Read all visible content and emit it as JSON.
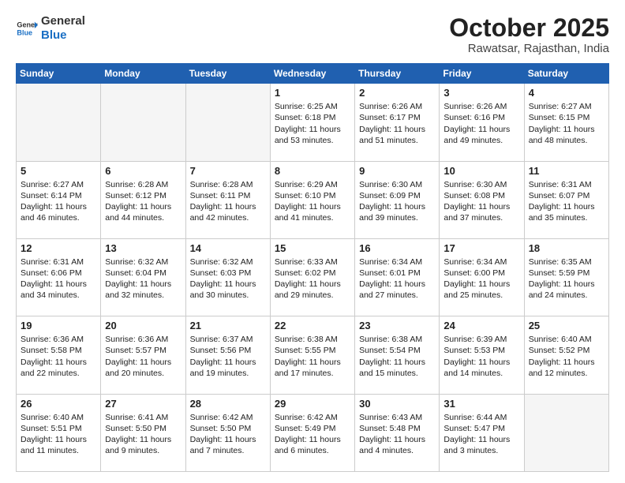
{
  "header": {
    "logo_general": "General",
    "logo_blue": "Blue",
    "month_title": "October 2025",
    "location": "Rawatsar, Rajasthan, India"
  },
  "days_of_week": [
    "Sunday",
    "Monday",
    "Tuesday",
    "Wednesday",
    "Thursday",
    "Friday",
    "Saturday"
  ],
  "weeks": [
    [
      {
        "day": "",
        "lines": [],
        "empty": true
      },
      {
        "day": "",
        "lines": [],
        "empty": true
      },
      {
        "day": "",
        "lines": [],
        "empty": true
      },
      {
        "day": "1",
        "lines": [
          "Sunrise: 6:25 AM",
          "Sunset: 6:18 PM",
          "Daylight: 11 hours",
          "and 53 minutes."
        ],
        "empty": false
      },
      {
        "day": "2",
        "lines": [
          "Sunrise: 6:26 AM",
          "Sunset: 6:17 PM",
          "Daylight: 11 hours",
          "and 51 minutes."
        ],
        "empty": false
      },
      {
        "day": "3",
        "lines": [
          "Sunrise: 6:26 AM",
          "Sunset: 6:16 PM",
          "Daylight: 11 hours",
          "and 49 minutes."
        ],
        "empty": false
      },
      {
        "day": "4",
        "lines": [
          "Sunrise: 6:27 AM",
          "Sunset: 6:15 PM",
          "Daylight: 11 hours",
          "and 48 minutes."
        ],
        "empty": false
      }
    ],
    [
      {
        "day": "5",
        "lines": [
          "Sunrise: 6:27 AM",
          "Sunset: 6:14 PM",
          "Daylight: 11 hours",
          "and 46 minutes."
        ],
        "empty": false
      },
      {
        "day": "6",
        "lines": [
          "Sunrise: 6:28 AM",
          "Sunset: 6:12 PM",
          "Daylight: 11 hours",
          "and 44 minutes."
        ],
        "empty": false
      },
      {
        "day": "7",
        "lines": [
          "Sunrise: 6:28 AM",
          "Sunset: 6:11 PM",
          "Daylight: 11 hours",
          "and 42 minutes."
        ],
        "empty": false
      },
      {
        "day": "8",
        "lines": [
          "Sunrise: 6:29 AM",
          "Sunset: 6:10 PM",
          "Daylight: 11 hours",
          "and 41 minutes."
        ],
        "empty": false
      },
      {
        "day": "9",
        "lines": [
          "Sunrise: 6:30 AM",
          "Sunset: 6:09 PM",
          "Daylight: 11 hours",
          "and 39 minutes."
        ],
        "empty": false
      },
      {
        "day": "10",
        "lines": [
          "Sunrise: 6:30 AM",
          "Sunset: 6:08 PM",
          "Daylight: 11 hours",
          "and 37 minutes."
        ],
        "empty": false
      },
      {
        "day": "11",
        "lines": [
          "Sunrise: 6:31 AM",
          "Sunset: 6:07 PM",
          "Daylight: 11 hours",
          "and 35 minutes."
        ],
        "empty": false
      }
    ],
    [
      {
        "day": "12",
        "lines": [
          "Sunrise: 6:31 AM",
          "Sunset: 6:06 PM",
          "Daylight: 11 hours",
          "and 34 minutes."
        ],
        "empty": false
      },
      {
        "day": "13",
        "lines": [
          "Sunrise: 6:32 AM",
          "Sunset: 6:04 PM",
          "Daylight: 11 hours",
          "and 32 minutes."
        ],
        "empty": false
      },
      {
        "day": "14",
        "lines": [
          "Sunrise: 6:32 AM",
          "Sunset: 6:03 PM",
          "Daylight: 11 hours",
          "and 30 minutes."
        ],
        "empty": false
      },
      {
        "day": "15",
        "lines": [
          "Sunrise: 6:33 AM",
          "Sunset: 6:02 PM",
          "Daylight: 11 hours",
          "and 29 minutes."
        ],
        "empty": false
      },
      {
        "day": "16",
        "lines": [
          "Sunrise: 6:34 AM",
          "Sunset: 6:01 PM",
          "Daylight: 11 hours",
          "and 27 minutes."
        ],
        "empty": false
      },
      {
        "day": "17",
        "lines": [
          "Sunrise: 6:34 AM",
          "Sunset: 6:00 PM",
          "Daylight: 11 hours",
          "and 25 minutes."
        ],
        "empty": false
      },
      {
        "day": "18",
        "lines": [
          "Sunrise: 6:35 AM",
          "Sunset: 5:59 PM",
          "Daylight: 11 hours",
          "and 24 minutes."
        ],
        "empty": false
      }
    ],
    [
      {
        "day": "19",
        "lines": [
          "Sunrise: 6:36 AM",
          "Sunset: 5:58 PM",
          "Daylight: 11 hours",
          "and 22 minutes."
        ],
        "empty": false
      },
      {
        "day": "20",
        "lines": [
          "Sunrise: 6:36 AM",
          "Sunset: 5:57 PM",
          "Daylight: 11 hours",
          "and 20 minutes."
        ],
        "empty": false
      },
      {
        "day": "21",
        "lines": [
          "Sunrise: 6:37 AM",
          "Sunset: 5:56 PM",
          "Daylight: 11 hours",
          "and 19 minutes."
        ],
        "empty": false
      },
      {
        "day": "22",
        "lines": [
          "Sunrise: 6:38 AM",
          "Sunset: 5:55 PM",
          "Daylight: 11 hours",
          "and 17 minutes."
        ],
        "empty": false
      },
      {
        "day": "23",
        "lines": [
          "Sunrise: 6:38 AM",
          "Sunset: 5:54 PM",
          "Daylight: 11 hours",
          "and 15 minutes."
        ],
        "empty": false
      },
      {
        "day": "24",
        "lines": [
          "Sunrise: 6:39 AM",
          "Sunset: 5:53 PM",
          "Daylight: 11 hours",
          "and 14 minutes."
        ],
        "empty": false
      },
      {
        "day": "25",
        "lines": [
          "Sunrise: 6:40 AM",
          "Sunset: 5:52 PM",
          "Daylight: 11 hours",
          "and 12 minutes."
        ],
        "empty": false
      }
    ],
    [
      {
        "day": "26",
        "lines": [
          "Sunrise: 6:40 AM",
          "Sunset: 5:51 PM",
          "Daylight: 11 hours",
          "and 11 minutes."
        ],
        "empty": false
      },
      {
        "day": "27",
        "lines": [
          "Sunrise: 6:41 AM",
          "Sunset: 5:50 PM",
          "Daylight: 11 hours",
          "and 9 minutes."
        ],
        "empty": false
      },
      {
        "day": "28",
        "lines": [
          "Sunrise: 6:42 AM",
          "Sunset: 5:50 PM",
          "Daylight: 11 hours",
          "and 7 minutes."
        ],
        "empty": false
      },
      {
        "day": "29",
        "lines": [
          "Sunrise: 6:42 AM",
          "Sunset: 5:49 PM",
          "Daylight: 11 hours",
          "and 6 minutes."
        ],
        "empty": false
      },
      {
        "day": "30",
        "lines": [
          "Sunrise: 6:43 AM",
          "Sunset: 5:48 PM",
          "Daylight: 11 hours",
          "and 4 minutes."
        ],
        "empty": false
      },
      {
        "day": "31",
        "lines": [
          "Sunrise: 6:44 AM",
          "Sunset: 5:47 PM",
          "Daylight: 11 hours",
          "and 3 minutes."
        ],
        "empty": false
      },
      {
        "day": "",
        "lines": [],
        "empty": true
      }
    ]
  ]
}
